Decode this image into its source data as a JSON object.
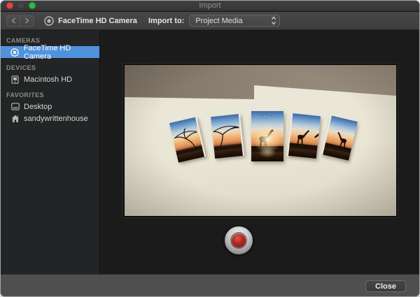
{
  "window": {
    "title": "Import"
  },
  "toolbar": {
    "device_name": "FaceTime HD Camera",
    "import_to_label": "Import to:",
    "import_to_value": "Project Media"
  },
  "sidebar": {
    "sections": [
      {
        "header": "CAMERAS",
        "items": [
          {
            "label": "FaceTime HD Camera",
            "icon": "camera-icon",
            "selected": true
          }
        ]
      },
      {
        "header": "DEVICES",
        "items": [
          {
            "label": "Macintosh HD",
            "icon": "hard-drive-icon",
            "selected": false
          }
        ]
      },
      {
        "header": "FAVORITES",
        "items": [
          {
            "label": "Desktop",
            "icon": "desktop-icon",
            "selected": false
          },
          {
            "label": "sandywrittenhouse",
            "icon": "home-icon",
            "selected": false
          }
        ]
      }
    ]
  },
  "footer": {
    "close_label": "Close"
  },
  "colors": {
    "selection_blue": "#4f93dc",
    "record_red": "#b02622",
    "traffic_red": "#dd4a43",
    "traffic_green": "#2fbb45",
    "wall_cream": "#eae6d6",
    "ceiling_taupe": "#938878"
  }
}
